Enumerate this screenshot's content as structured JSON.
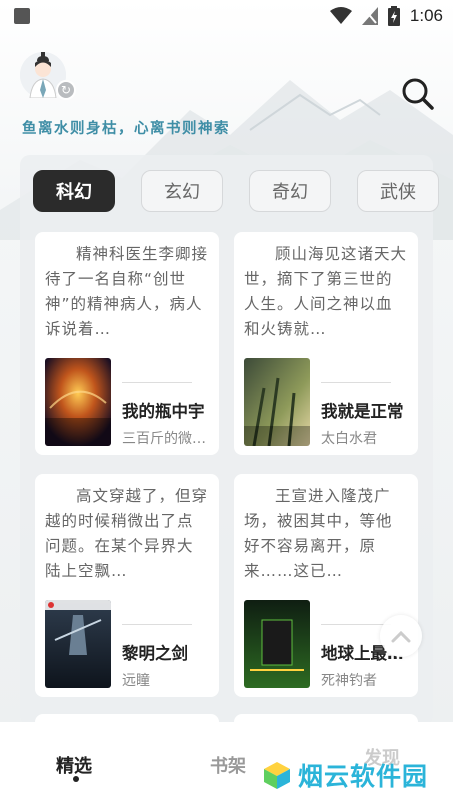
{
  "status_bar": {
    "time": "1:06"
  },
  "header": {
    "motto": "鱼离水则身枯，心离书则神索"
  },
  "tabs": [
    {
      "label": "科幻",
      "active": true
    },
    {
      "label": "玄幻",
      "active": false
    },
    {
      "label": "奇幻",
      "active": false
    },
    {
      "label": "武侠",
      "active": false
    }
  ],
  "books": [
    {
      "description": "精神科医生李卿接待了一名自称“创世神”的精神病人，病人诉说着…",
      "title": "我的瓶中宇",
      "author": "三百斤的微…",
      "cover_text": "瓶中宇宙",
      "cover_publisher": "起点中文网"
    },
    {
      "description": "顾山海见这诸天大世，摘下了第三世的人生。人间之神以血和火铸就…",
      "title": "我就是正常",
      "author": "太白水君",
      "cover_text": "我就是正常玩家",
      "cover_publisher": "起点中文网"
    },
    {
      "description": "高文穿越了，但穿越的时候稍微出了点问题。在某个异界大陆上空飘…",
      "title": "黎明之剑",
      "author": "远瞳",
      "cover_text": "黎明之剑",
      "cover_subtext": "The sword of Dawn",
      "cover_publisher": "起点中文网"
    },
    {
      "description": "王宣进入隆茂广场，被困其中，等他好不容易离开，原来……这已…",
      "title": "地球上最后…",
      "author": "死神钓者",
      "cover_text": "最后一栋楼",
      "cover_publisher": "起点中文网"
    }
  ],
  "bottom_nav": [
    {
      "label": "精选",
      "active": true
    },
    {
      "label": "书架",
      "active": false
    },
    {
      "label": "发现",
      "active": false
    }
  ],
  "watermark": {
    "text": "烟云软件园"
  },
  "colors": {
    "accent": "#3f8ea6",
    "watermark": "#2bb4d9",
    "tab_active_bg": "#2b2b2b"
  }
}
